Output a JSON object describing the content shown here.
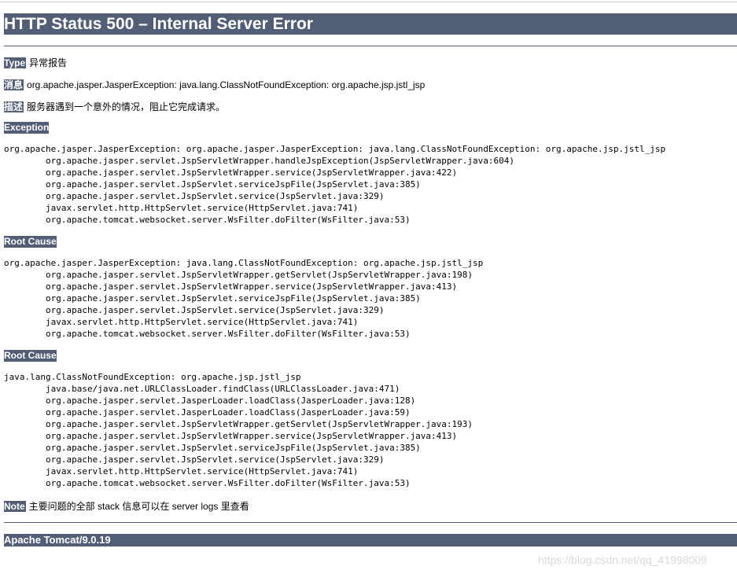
{
  "page": {
    "title": "HTTP Status 500 – Internal Server Error",
    "type_label": "Type",
    "type_value": "异常报告",
    "message_label": "消息",
    "message_value": "org.apache.jasper.JasperException: java.lang.ClassNotFoundException: org.apache.jsp.jstl_jsp",
    "description_label": "描述",
    "description_value": "服务器遇到一个意外的情况，阻止它完成请求。",
    "exception_heading": "Exception",
    "exception_trace": "org.apache.jasper.JasperException: org.apache.jasper.JasperException: java.lang.ClassNotFoundException: org.apache.jsp.jstl_jsp\n\torg.apache.jasper.servlet.JspServletWrapper.handleJspException(JspServletWrapper.java:604)\n\torg.apache.jasper.servlet.JspServletWrapper.service(JspServletWrapper.java:422)\n\torg.apache.jasper.servlet.JspServlet.serviceJspFile(JspServlet.java:385)\n\torg.apache.jasper.servlet.JspServlet.service(JspServlet.java:329)\n\tjavax.servlet.http.HttpServlet.service(HttpServlet.java:741)\n\torg.apache.tomcat.websocket.server.WsFilter.doFilter(WsFilter.java:53)",
    "root_cause_heading_1": "Root Cause",
    "root_cause_trace_1": "org.apache.jasper.JasperException: java.lang.ClassNotFoundException: org.apache.jsp.jstl_jsp\n\torg.apache.jasper.servlet.JspServletWrapper.getServlet(JspServletWrapper.java:198)\n\torg.apache.jasper.servlet.JspServletWrapper.service(JspServletWrapper.java:413)\n\torg.apache.jasper.servlet.JspServlet.serviceJspFile(JspServlet.java:385)\n\torg.apache.jasper.servlet.JspServlet.service(JspServlet.java:329)\n\tjavax.servlet.http.HttpServlet.service(HttpServlet.java:741)\n\torg.apache.tomcat.websocket.server.WsFilter.doFilter(WsFilter.java:53)",
    "root_cause_heading_2": "Root Cause",
    "root_cause_trace_2": "java.lang.ClassNotFoundException: org.apache.jsp.jstl_jsp\n\tjava.base/java.net.URLClassLoader.findClass(URLClassLoader.java:471)\n\torg.apache.jasper.servlet.JasperLoader.loadClass(JasperLoader.java:128)\n\torg.apache.jasper.servlet.JasperLoader.loadClass(JasperLoader.java:59)\n\torg.apache.jasper.servlet.JspServletWrapper.getServlet(JspServletWrapper.java:193)\n\torg.apache.jasper.servlet.JspServletWrapper.service(JspServletWrapper.java:413)\n\torg.apache.jasper.servlet.JspServlet.serviceJspFile(JspServlet.java:385)\n\torg.apache.jasper.servlet.JspServlet.service(JspServlet.java:329)\n\tjavax.servlet.http.HttpServlet.service(HttpServlet.java:741)\n\torg.apache.tomcat.websocket.server.WsFilter.doFilter(WsFilter.java:53)",
    "note_label": "Note",
    "note_value": "主要问题的全部 stack 信息可以在 server logs 里查看",
    "footer": "Apache Tomcat/9.0.19",
    "watermark": "https://blog.csdn.net/qq_41998009"
  },
  "colors": {
    "header_background": "#525d76",
    "header_text": "#ffffff",
    "body_text": "#000000",
    "watermark_text": "#d9d9d9"
  }
}
